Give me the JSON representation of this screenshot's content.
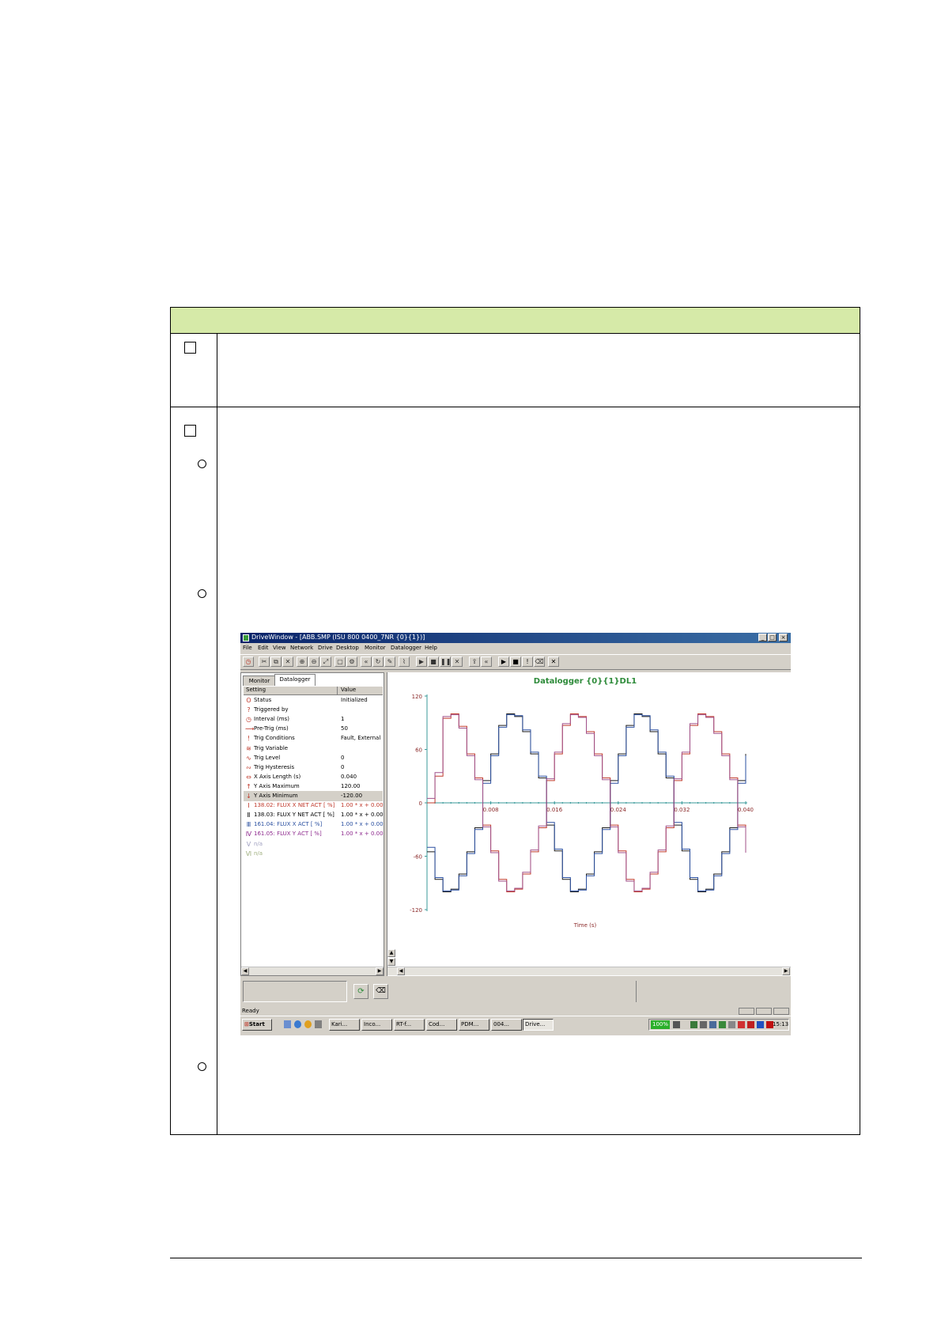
{
  "window": {
    "title": "DriveWindow - [ABB.SMP (ISU 800 0400_7NR {0}{1})]",
    "controls": [
      "_",
      "□",
      "×"
    ]
  },
  "menu": [
    "File",
    "Edit",
    "View",
    "Network",
    "Drive",
    "Desktop",
    "Monitor",
    "Datalogger",
    "Help"
  ],
  "tabs": [
    "Monitor",
    "Datalogger"
  ],
  "settings_grid": {
    "header_setting": "Setting",
    "header_value": "Value",
    "rows": [
      {
        "name": "Status",
        "value": "Initialized",
        "icon": "status-icon",
        "color": "#000000"
      },
      {
        "name": "Triggered by",
        "value": "",
        "icon": "trigger-icon",
        "color": "#000000"
      },
      {
        "name": "Interval (ms)",
        "value": "1",
        "icon": "clock-icon",
        "color": "#000000"
      },
      {
        "name": "Pre-Trig (ms)",
        "value": "50",
        "icon": "pretrig-icon",
        "color": "#000000"
      },
      {
        "name": "Trig Conditions",
        "value": "Fault, External",
        "icon": "exclamation-icon",
        "color": "#000000"
      },
      {
        "name": "Trig Variable",
        "value": "",
        "icon": "variable-icon",
        "color": "#000000"
      },
      {
        "name": "Trig Level",
        "value": "0",
        "icon": "level-icon",
        "color": "#000000"
      },
      {
        "name": "Trig Hysteresis",
        "value": "0",
        "icon": "hysteresis-icon",
        "color": "#000000"
      },
      {
        "name": "X Axis Length (s)",
        "value": "0.040",
        "icon": "x-axis-icon",
        "color": "#000000"
      },
      {
        "name": "Y Axis Maximum",
        "value": "120.00",
        "icon": "up-arrow-icon",
        "color": "#000000"
      },
      {
        "name": "Y Axis Minimum",
        "value": "-120.00",
        "icon": "down-arrow-icon",
        "color": "#000000"
      },
      {
        "name": "138.02: FLUX X NET ACT [   %]",
        "value": "1.00 * x + 0.00",
        "icon": "channel-1-icon",
        "color": "#c0392b"
      },
      {
        "name": "138.03: FLUX Y NET ACT [   %]",
        "value": "1.00 * x + 0.00",
        "icon": "channel-2-icon",
        "color": "#000000"
      },
      {
        "name": "161.04: FLUX X ACT [   %]",
        "value": "1.00 * x + 0.00",
        "icon": "channel-3-icon",
        "color": "#2a4fa0"
      },
      {
        "name": "161.05: FLUX Y ACT [   %]",
        "value": "1.00 * x + 0.00",
        "icon": "channel-4-icon",
        "color": "#8e2a8e"
      },
      {
        "name": "n/a",
        "value": "",
        "icon": "channel-5-icon",
        "color": "#a0a0c0"
      },
      {
        "name": "n/a",
        "value": "",
        "icon": "channel-6-icon",
        "color": "#a0b080"
      }
    ]
  },
  "chart_data": {
    "type": "line",
    "title": "Datalogger {0}{1}DL1",
    "xlabel": "Time (s)",
    "ylabel": "",
    "xlim": [
      0,
      0.04
    ],
    "ylim": [
      -120,
      120
    ],
    "x_ticks": [
      "0.008",
      "0.016",
      "0.024",
      "0.032",
      "0.040"
    ],
    "y_ticks": [
      "120",
      "60",
      "0",
      "-60",
      "-120"
    ],
    "grid": false,
    "legend": "none",
    "series": [
      {
        "color": "#c0392b",
        "values": [
          0,
          30,
          95,
          100,
          86,
          55,
          28,
          -25,
          -54,
          -86,
          -100,
          -97,
          -80,
          -55,
          -28,
          25,
          55,
          87,
          100,
          97,
          80,
          55,
          28,
          -25,
          -54,
          -86,
          -100,
          -97,
          -80,
          -55,
          -28,
          25,
          55,
          87,
          100,
          97,
          80,
          55,
          28,
          -25,
          -54
        ],
        "x_step": 0.001
      },
      {
        "color": "#1a1a1a",
        "values": [
          -55,
          -86,
          -100,
          -97,
          -80,
          -55,
          -28,
          25,
          55,
          87,
          100,
          97,
          80,
          55,
          28,
          -25,
          -54,
          -86,
          -100,
          -97,
          -80,
          -55,
          -28,
          25,
          55,
          87,
          100,
          97,
          80,
          55,
          28,
          -25,
          -54,
          -86,
          -100,
          -97,
          -80,
          -55,
          -28,
          25,
          55
        ],
        "x_step": 0.001
      },
      {
        "color": "#2a4fa0",
        "values": [
          -50,
          -84,
          -99,
          -98,
          -82,
          -57,
          -30,
          22,
          53,
          85,
          99,
          98,
          82,
          57,
          30,
          -22,
          -52,
          -84,
          -99,
          -98,
          -82,
          -57,
          -30,
          22,
          53,
          85,
          99,
          98,
          82,
          57,
          30,
          -22,
          -52,
          -84,
          -99,
          -98,
          -82,
          -57,
          -30,
          22,
          53
        ],
        "x_step": 0.001
      },
      {
        "color": "#a0508a",
        "values": [
          5,
          34,
          97,
          99,
          84,
          53,
          26,
          -27,
          -56,
          -88,
          -99,
          -96,
          -78,
          -53,
          -26,
          27,
          57,
          89,
          99,
          96,
          78,
          53,
          26,
          -27,
          -56,
          -88,
          -99,
          -96,
          -78,
          -53,
          -26,
          27,
          57,
          89,
          99,
          96,
          78,
          53,
          26,
          -27,
          -56
        ],
        "x_step": 0.001
      }
    ]
  },
  "status": {
    "text": "Ready"
  },
  "taskbar": {
    "start": "Start",
    "tasks": [
      "Kari...",
      "Inco...",
      "RT-f...",
      "Cod...",
      "PDM...",
      "004...",
      "Drive..."
    ],
    "battery": "100%",
    "clock": "15:13"
  },
  "colors": {
    "table_header": "#d6eaa8",
    "chart_title": "#2e8b3a",
    "axis": "#3a9a9a"
  }
}
